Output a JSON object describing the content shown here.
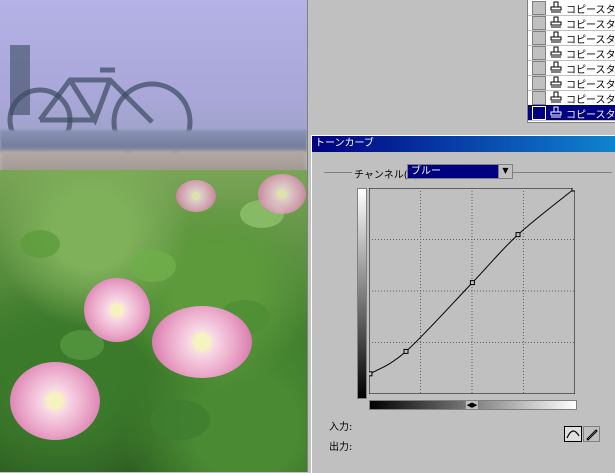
{
  "layers_panel": {
    "items": [
      {
        "label": "コピースタン",
        "selected": false
      },
      {
        "label": "コピースタン",
        "selected": false
      },
      {
        "label": "コピースタン",
        "selected": false
      },
      {
        "label": "コピースタン",
        "selected": false
      },
      {
        "label": "コピースタン",
        "selected": false
      },
      {
        "label": "コピースタン",
        "selected": false
      },
      {
        "label": "コピースタン",
        "selected": false
      },
      {
        "label": "コピースタン",
        "selected": true
      }
    ]
  },
  "dialog": {
    "title": "トーンカーブ",
    "channel_label": "チャンネル(C):",
    "channel_value": "ブルー",
    "input_label": "入力:",
    "output_label": "出力:"
  },
  "curve": {
    "points": [
      [
        0,
        24
      ],
      [
        45,
        52
      ],
      [
        128,
        138
      ],
      [
        185,
        198
      ],
      [
        255,
        255
      ]
    ],
    "grid_divisions": 4
  },
  "colors": {
    "title_bar": "#000080",
    "selection": "#000080",
    "dialog_bg": "#c0c0c0"
  },
  "icons": [
    "eye-checkbox-icon",
    "stamp-icon",
    "dropdown-arrow-icon",
    "curve-tool-icon",
    "pencil-tool-icon"
  ]
}
